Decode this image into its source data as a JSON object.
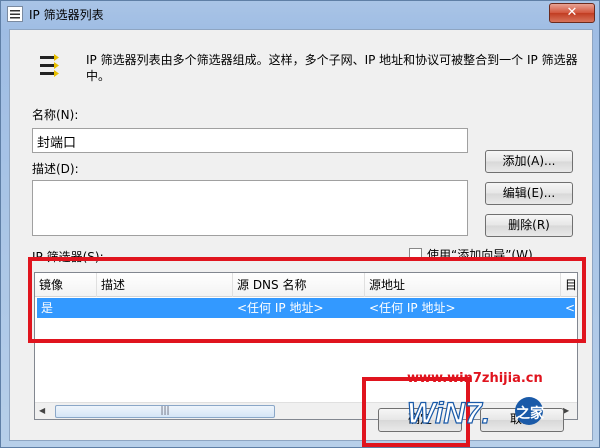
{
  "window": {
    "title": "IP 筛选器列表",
    "close_label": "✕"
  },
  "description": "IP 筛选器列表由多个筛选器组成。这样，多个子网、IP 地址和协议可被整合到一个 IP 筛选器中。",
  "name_field": {
    "label": "名称(N):",
    "value": "封端口"
  },
  "desc_field": {
    "label": "描述(D):",
    "value": ""
  },
  "buttons": {
    "add": "添加(A)...",
    "edit": "编辑(E)...",
    "delete": "删除(R)",
    "ok": "确定",
    "cancel": "取消"
  },
  "filters": {
    "label": "IP 筛选器(S):",
    "use_wizard_label": "使用“添加向导”(W)",
    "use_wizard_checked": false,
    "columns": [
      "镜像",
      "描述",
      "源 DNS 名称",
      "源地址",
      "目"
    ],
    "rows": [
      [
        "是",
        "",
        "<任何 IP 地址>",
        "<任何 IP 地址>",
        "<"
      ]
    ]
  },
  "watermark": {
    "url": "www.win7zhijia.cn",
    "logo_text": "WiN7.",
    "logo_suffix": "之家"
  },
  "colors": {
    "selection": "#3399ff",
    "highlight_red": "#e0141e",
    "title_bar": "#a9c4e6"
  }
}
